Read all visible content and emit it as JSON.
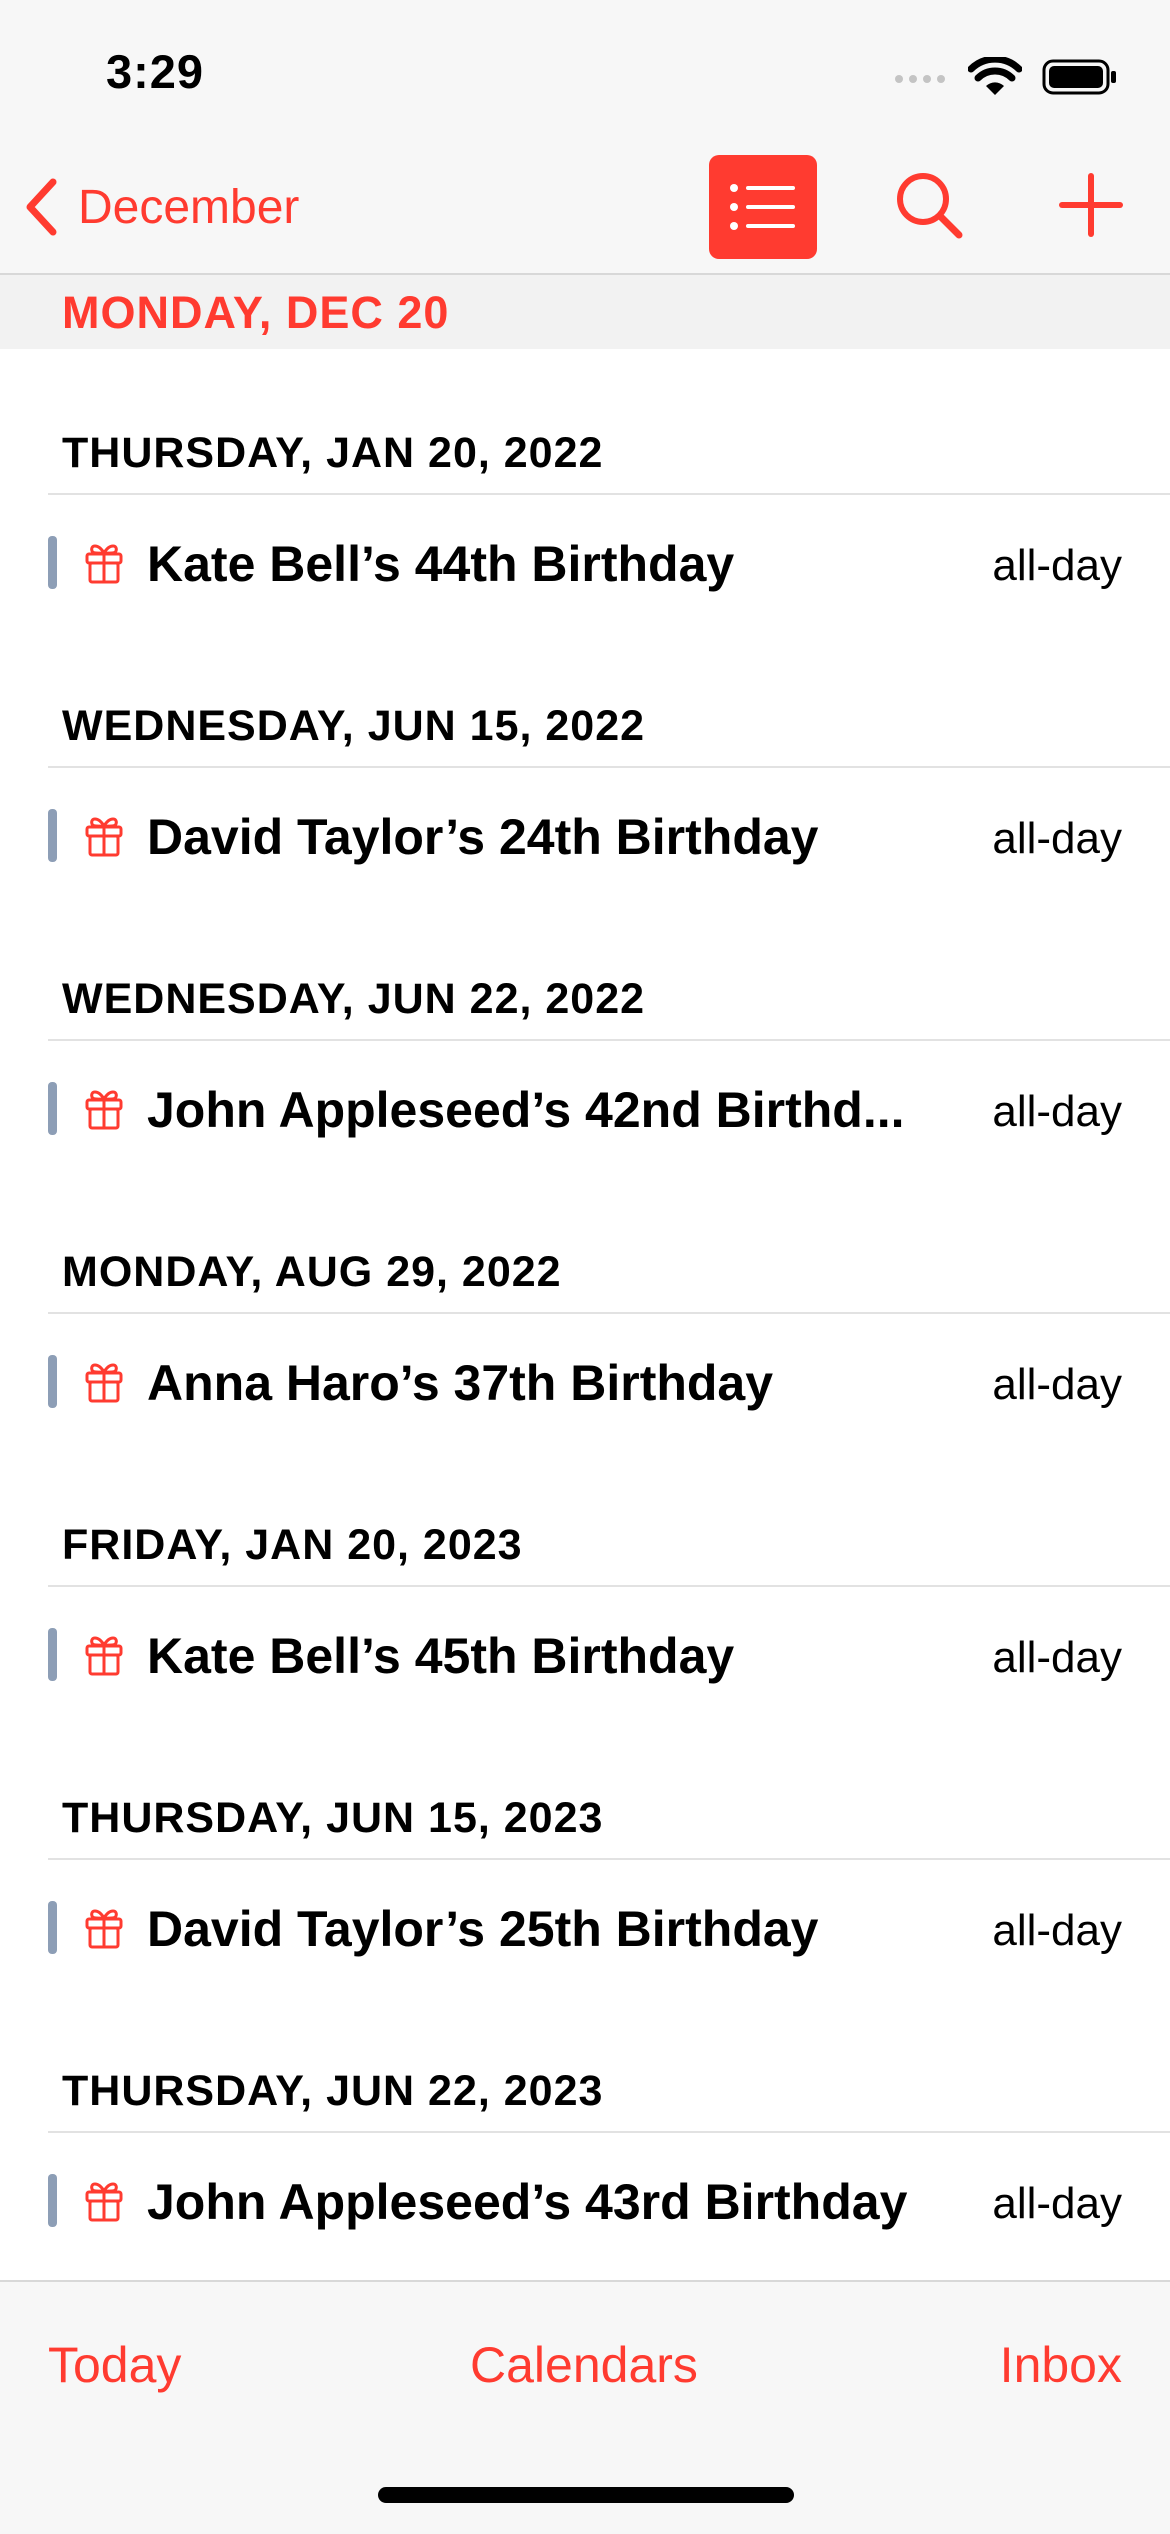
{
  "status_bar": {
    "time": "3:29"
  },
  "nav": {
    "back_label": "December"
  },
  "sticky_header": "MONDAY, DEC 20",
  "events": [
    {
      "date": "THURSDAY, JAN 20, 2022",
      "title": "Kate Bell’s 44th Birthday",
      "time": "all-day"
    },
    {
      "date": "WEDNESDAY, JUN 15, 2022",
      "title": "David Taylor’s 24th Birthday",
      "time": "all-day"
    },
    {
      "date": "WEDNESDAY, JUN 22, 2022",
      "title": "John Appleseed’s 42nd Birthd...",
      "time": "all-day"
    },
    {
      "date": "MONDAY, AUG 29, 2022",
      "title": "Anna Haro’s 37th Birthday",
      "time": "all-day"
    },
    {
      "date": "FRIDAY, JAN 20, 2023",
      "title": "Kate Bell’s 45th Birthday",
      "time": "all-day"
    },
    {
      "date": "THURSDAY, JUN 15, 2023",
      "title": "David Taylor’s 25th Birthday",
      "time": "all-day"
    },
    {
      "date": "THURSDAY, JUN 22, 2023",
      "title": "John Appleseed’s 43rd Birthday",
      "time": "all-day"
    }
  ],
  "tabs": {
    "today": "Today",
    "calendars": "Calendars",
    "inbox": "Inbox"
  },
  "colors": {
    "accent": "#ff3b30",
    "calendar_bar": "#8d9eb6"
  },
  "icons": {
    "back": "chevron-left-icon",
    "list": "list-icon",
    "search": "search-icon",
    "add": "plus-icon",
    "event": "gift-icon"
  }
}
